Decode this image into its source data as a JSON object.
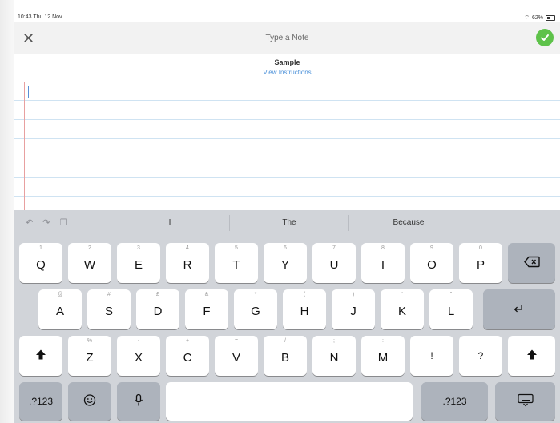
{
  "status_bar": {
    "time": "10:43  Thu 12 Nov",
    "battery": "62%"
  },
  "nav": {
    "title": "Type a Note",
    "close_glyph": "✕",
    "done_icon": "checkmark-circle-icon"
  },
  "header": {
    "title": "Sample",
    "link": "View Instructions"
  },
  "colors": {
    "accent_green": "#5ec24a",
    "link_blue": "#4a90d9",
    "keyboard_bg": "#d1d4d9"
  },
  "keyboard": {
    "suggestions": [
      "I",
      "The",
      "Because"
    ],
    "row1": [
      {
        "top": "1",
        "label": "Q"
      },
      {
        "top": "2",
        "label": "W"
      },
      {
        "top": "3",
        "label": "E"
      },
      {
        "top": "4",
        "label": "R"
      },
      {
        "top": "5",
        "label": "T"
      },
      {
        "top": "6",
        "label": "Y"
      },
      {
        "top": "7",
        "label": "U"
      },
      {
        "top": "8",
        "label": "I"
      },
      {
        "top": "9",
        "label": "O"
      },
      {
        "top": "0",
        "label": "P"
      }
    ],
    "row2": [
      {
        "top": "@",
        "label": "A"
      },
      {
        "top": "#",
        "label": "S"
      },
      {
        "top": "£",
        "label": "D"
      },
      {
        "top": "&",
        "label": "F"
      },
      {
        "top": "*",
        "label": "G"
      },
      {
        "top": "(",
        "label": "H"
      },
      {
        "top": ")",
        "label": "J"
      },
      {
        "top": "'",
        "label": "K"
      },
      {
        "top": "\"",
        "label": "L"
      }
    ],
    "row3": [
      {
        "top": "%",
        "label": "Z"
      },
      {
        "top": "-",
        "label": "X"
      },
      {
        "top": "+",
        "label": "C"
      },
      {
        "top": "=",
        "label": "V"
      },
      {
        "top": "/",
        "label": "B"
      },
      {
        "top": ";",
        "label": "N"
      },
      {
        "top": ":",
        "label": "M"
      },
      {
        "top": "",
        "label": "!"
      },
      {
        "top": "",
        "label": "?"
      }
    ],
    "numbers_label": ".?123",
    "numbers_label_right": ".?123"
  }
}
